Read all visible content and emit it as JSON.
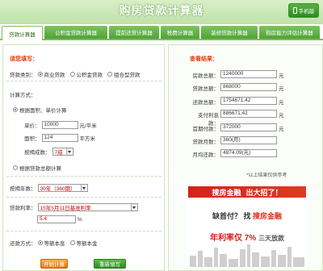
{
  "header": {
    "title": "购房贷款计算器",
    "mobile_label": "手机版"
  },
  "tabs": [
    "贷款计算器",
    "公积金贷款计算器",
    "提前还贷计算器",
    "税费计算器",
    "装修贷款计算器",
    "购房能力评估计算器"
  ],
  "form": {
    "section_title": "请您填写：",
    "loan_type": {
      "label": "贷款类别：",
      "options": [
        "商业贷款",
        "公积金贷款",
        "组合型贷款"
      ],
      "selected": 0
    },
    "calc_method": {
      "label": "计算方式：",
      "by_area_label": "根据面积、单价计算",
      "unit_price_label": "单价：",
      "unit_price_value": "10000",
      "unit_price_unit": "元/平米",
      "area_label": "面积：",
      "area_value": "124",
      "area_unit": "平方米",
      "ratio_label": "按揭成数：",
      "ratio_value": "7成",
      "by_total_label": "根据贷款总额计算"
    },
    "years": {
      "label": "按揭年数：",
      "value": "30年（360期）"
    },
    "rate": {
      "label": "贷款利率：",
      "select_value": "15年5月11日基准利率",
      "value": "5.4",
      "unit": "%"
    },
    "repay": {
      "label": "还款方式：",
      "options": [
        "等额本息",
        "等额本金"
      ],
      "selected": 0
    },
    "calc_button": "开始计算",
    "reset_button": "重新填写"
  },
  "results": {
    "section_title": "查看结果：",
    "rows": [
      {
        "label": "房款总额：",
        "value": "1240000",
        "unit": "元"
      },
      {
        "label": "贷款总额：",
        "value": "868000",
        "unit": "元"
      },
      {
        "label": "还款总额：",
        "value": "1754671.42",
        "unit": "元"
      },
      {
        "label": "支付利息款：",
        "value": "886671.42",
        "unit": "元"
      },
      {
        "label": "首期付款：",
        "value": "372000",
        "unit": "元"
      },
      {
        "label": "贷款月数：",
        "value": "360(月)",
        "unit": ""
      },
      {
        "label": "月均还款：",
        "value": "4874.09(元)",
        "unit": ""
      }
    ],
    "note": "*以上结果仅供参考"
  },
  "banner": {
    "headline_a": "搜房金融",
    "headline_b": "出大招了！",
    "question_a": "缺首付？",
    "question_b": "找",
    "question_brand": "搜房金融",
    "rate_text": "年利率仅 7%",
    "rate_suffix": "三天放款"
  },
  "colors": {
    "accent_green": "#4fa236",
    "title_red": "#e04010",
    "banner_red": "#d8201c"
  }
}
